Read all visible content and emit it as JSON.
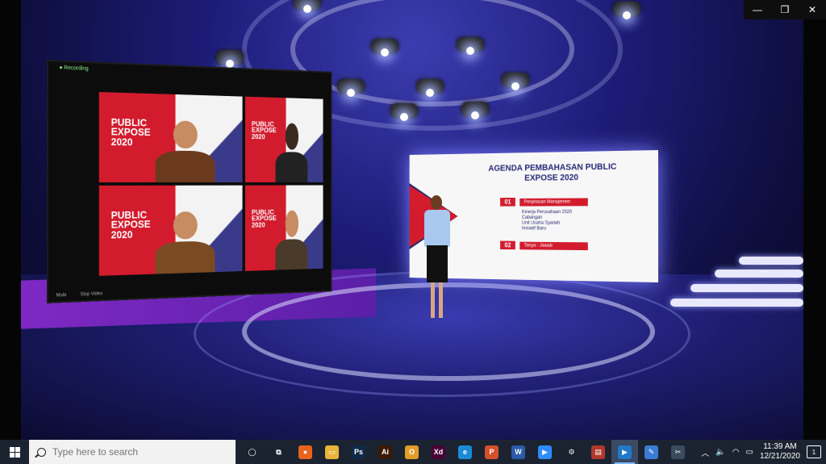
{
  "window": {
    "minimize_label": "—",
    "restore_label": "❐",
    "close_label": "✕"
  },
  "zoom_wall": {
    "app_label": "● Recording",
    "tiles": [
      {
        "title": "PUBLIC EXPOSE 2020"
      },
      {
        "title": "PUBLIC EXPOSE 2020"
      },
      {
        "title": "PUBLIC EXPOSE 2020"
      },
      {
        "title": "PUBLIC EXPOSE 2020"
      }
    ],
    "controls": [
      "Mute",
      "Stop Video"
    ]
  },
  "agenda": {
    "title": "AGENDA PEMBAHASAN PUBLIC EXPOSE 2020",
    "items": [
      {
        "number": "01",
        "label": "Penjelasan Manajemen"
      },
      {
        "number": "02",
        "label": "Tanya - Jawab"
      }
    ],
    "subitems": [
      "Kinerja Perusahaan 2020",
      "Cabangan",
      "Unit Usaha Syariah",
      "Inisiatif Baru"
    ]
  },
  "taskbar": {
    "search_placeholder": "Type here to search",
    "apps": [
      {
        "name": "task-view-icon",
        "glyph": "◯",
        "color": "#1c2330"
      },
      {
        "name": "multitask-icon",
        "glyph": "⧉",
        "color": "#1c2330"
      },
      {
        "name": "firefox-icon",
        "glyph": "●",
        "color": "#e8631d"
      },
      {
        "name": "file-explorer-icon",
        "glyph": "▭",
        "color": "#e9b43a"
      },
      {
        "name": "photoshop-icon",
        "glyph": "Ps",
        "color": "#0f2a4a"
      },
      {
        "name": "illustrator-icon",
        "glyph": "Ai",
        "color": "#3a1a05"
      },
      {
        "name": "outlook-icon",
        "glyph": "O",
        "color": "#e39b2a"
      },
      {
        "name": "xd-icon",
        "glyph": "Xd",
        "color": "#470137"
      },
      {
        "name": "edge-icon",
        "glyph": "e",
        "color": "#1a8ad6"
      },
      {
        "name": "powerpoint-icon",
        "glyph": "P",
        "color": "#d3512b"
      },
      {
        "name": "word-icon",
        "glyph": "W",
        "color": "#2b5aa8"
      },
      {
        "name": "zoom-icon",
        "glyph": "▶",
        "color": "#2d8cff"
      },
      {
        "name": "settings-icon",
        "glyph": "⚙",
        "color": "#1c2330"
      },
      {
        "name": "archive-icon",
        "glyph": "▤",
        "color": "#b0382c"
      },
      {
        "name": "media-player-icon",
        "glyph": "▶",
        "color": "#1f7ac7"
      },
      {
        "name": "paint-icon",
        "glyph": "✎",
        "color": "#3a7bd5"
      },
      {
        "name": "snip-icon",
        "glyph": "✂",
        "color": "#3c4a60"
      }
    ],
    "time": "11:39 AM",
    "date": "12/21/2020",
    "notification_count": "1"
  }
}
